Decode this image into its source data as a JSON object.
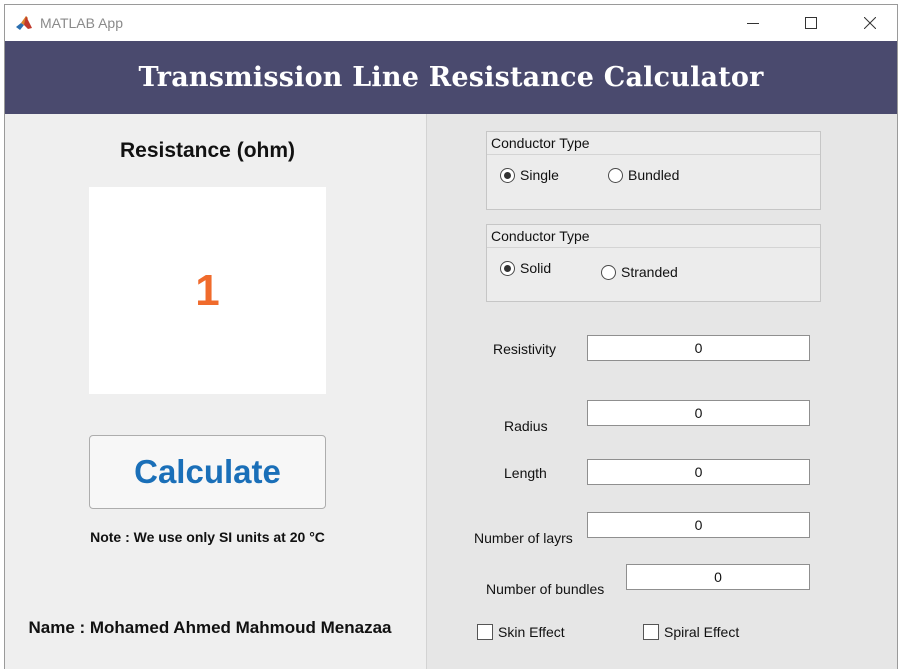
{
  "window": {
    "title": "MATLAB App",
    "controls": {
      "minimize": "minimize-icon",
      "maximize": "maximize-icon",
      "close": "close-icon"
    }
  },
  "banner": {
    "title": "Transmission Line Resistance Calculator"
  },
  "result": {
    "label": "Resistance (ohm)",
    "value": "1"
  },
  "calculate": {
    "label": "Calculate"
  },
  "note": "Note : We use only SI units at 20 °C",
  "author": "Name : Mohamed Ahmed Mahmoud Menazaa",
  "conductor_type_1": {
    "title": "Conductor Type",
    "options": [
      {
        "label": "Single",
        "selected": true
      },
      {
        "label": "Bundled",
        "selected": false
      }
    ]
  },
  "conductor_type_2": {
    "title": "Conductor Type",
    "options": [
      {
        "label": "Solid",
        "selected": true
      },
      {
        "label": "Stranded",
        "selected": false
      }
    ]
  },
  "fields": {
    "resistivity": {
      "label": "Resistivity",
      "value": "0"
    },
    "radius": {
      "label": "Radius",
      "value": "0"
    },
    "length": {
      "label": "Length",
      "value": "0"
    },
    "layers": {
      "label": "Number of layrs",
      "value": "0"
    },
    "bundles": {
      "label": "Number of bundles",
      "value": "0"
    }
  },
  "checkboxes": {
    "skin": {
      "label": "Skin Effect",
      "checked": false
    },
    "spiral": {
      "label": "Spiral Effect",
      "checked": false
    }
  },
  "colors": {
    "banner": "#4a4a6e",
    "result_value": "#f06b2c",
    "calculate_text": "#1a6fb8"
  }
}
